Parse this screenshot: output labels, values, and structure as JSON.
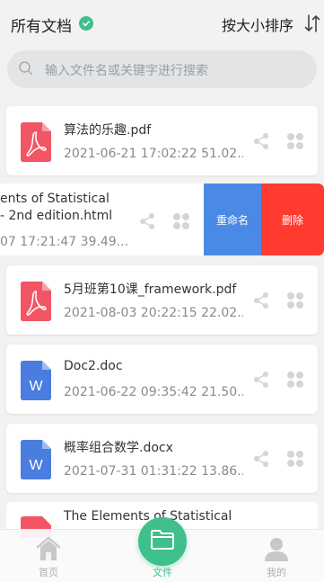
{
  "header": {
    "title": "所有文档",
    "sort_label": "按大小排序"
  },
  "search": {
    "placeholder": "输入文件名或关键字进行搜索"
  },
  "files": [
    {
      "name": "算法的乐趣.pdf",
      "meta": "2021-06-21 17:02:22   51.02...",
      "type": "pdf"
    },
    {
      "name": "5月班第10课_framework.pdf",
      "meta": "2021-08-03 20:22:15   22.02...",
      "type": "pdf"
    },
    {
      "name": "Doc2.doc",
      "meta": "2021-06-22 09:35:42   21.50...",
      "type": "doc"
    },
    {
      "name": "概率组合数学.docx",
      "meta": "2021-07-31 01:31:22   13.86...",
      "type": "doc"
    }
  ],
  "swiped_file": {
    "name_line1": "ents of Statistical",
    "name_line2": "- 2nd edition.html",
    "meta": "07 17:21:47   39.49...",
    "rename_label": "重命名",
    "delete_label": "删除"
  },
  "partial_file": {
    "name": "The Elements of Statistical"
  },
  "tabs": {
    "home": "首页",
    "files": "文件",
    "mine": "我的"
  },
  "colors": {
    "accent": "#3fbf8c",
    "pdf": "#f25563",
    "doc": "#4a7de0",
    "rename": "#4a8ae6",
    "delete": "#ff3b30"
  }
}
